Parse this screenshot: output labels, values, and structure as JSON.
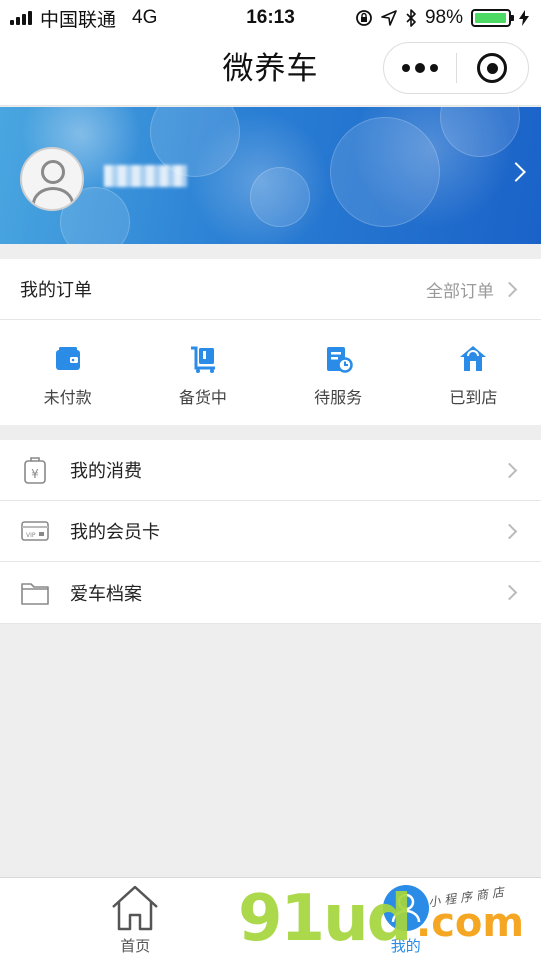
{
  "status_bar": {
    "carrier": "中国联通",
    "network": "4G",
    "time": "16:13",
    "battery": "98%",
    "battery_level": 0.98,
    "battery_color": "#4cd964"
  },
  "navbar": {
    "title": "微养车",
    "more_icon": "more-dots-icon",
    "close_icon": "target-circle-icon"
  },
  "profile": {
    "avatar_icon": "default-user-avatar-icon",
    "chevron_icon": "chevron-right-icon"
  },
  "orders": {
    "title": "我的订单",
    "all_label": "全部订单",
    "items": [
      {
        "label": "未付款",
        "icon": "wallet-icon"
      },
      {
        "label": "备货中",
        "icon": "cart-box-icon"
      },
      {
        "label": "待服务",
        "icon": "service-doc-icon"
      },
      {
        "label": "已到店",
        "icon": "store-home-icon"
      }
    ],
    "accent_color": "#2b8ce8"
  },
  "menu": [
    {
      "label": "我的消费",
      "icon": "yuan-bag-icon"
    },
    {
      "label": "我的会员卡",
      "icon": "vip-card-icon"
    },
    {
      "label": "爱车档案",
      "icon": "folder-icon"
    }
  ],
  "tabbar": {
    "tabs": [
      {
        "label": "首页",
        "icon": "home-icon",
        "active": false
      },
      {
        "label": "我的",
        "icon": "user-icon",
        "active": true
      }
    ]
  },
  "watermark": {
    "brand": "91ud",
    "domain": ".com",
    "slogan": "小程序商店"
  }
}
